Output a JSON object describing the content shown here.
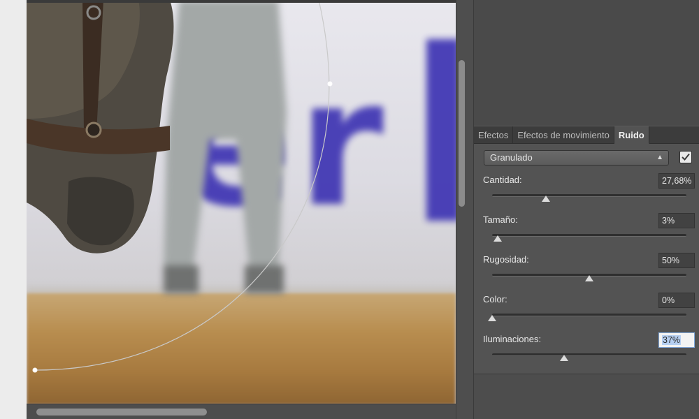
{
  "panel": {
    "tabs": [
      {
        "label": "Efectos",
        "active": false
      },
      {
        "label": "Efectos de movimiento",
        "active": false
      },
      {
        "label": "Ruido",
        "active": true
      }
    ],
    "noise_type": {
      "selected": "Granulado",
      "icon": "updown-arrows-icon"
    },
    "enabled_checkbox": {
      "checked": true,
      "icon": "checkmark-icon"
    },
    "sliders": [
      {
        "label": "Cantidad:",
        "value_text": "27,68%",
        "value": 0.2768,
        "selected": false
      },
      {
        "label": "Tamaño:",
        "value_text": "3%",
        "value": 0.03,
        "selected": false
      },
      {
        "label": "Rugosidad:",
        "value_text": "50%",
        "value": 0.5,
        "selected": false
      },
      {
        "label": "Color:",
        "value_text": "0%",
        "value": 0.0,
        "selected": false
      },
      {
        "label": "Iluminaciones:",
        "value_text": "37%",
        "value": 0.37,
        "selected": true
      }
    ]
  },
  "canvas": {
    "background_sign_text": "er",
    "colors": {
      "sign_blue": "#3e34b3",
      "ground": "#b88d4f"
    }
  }
}
